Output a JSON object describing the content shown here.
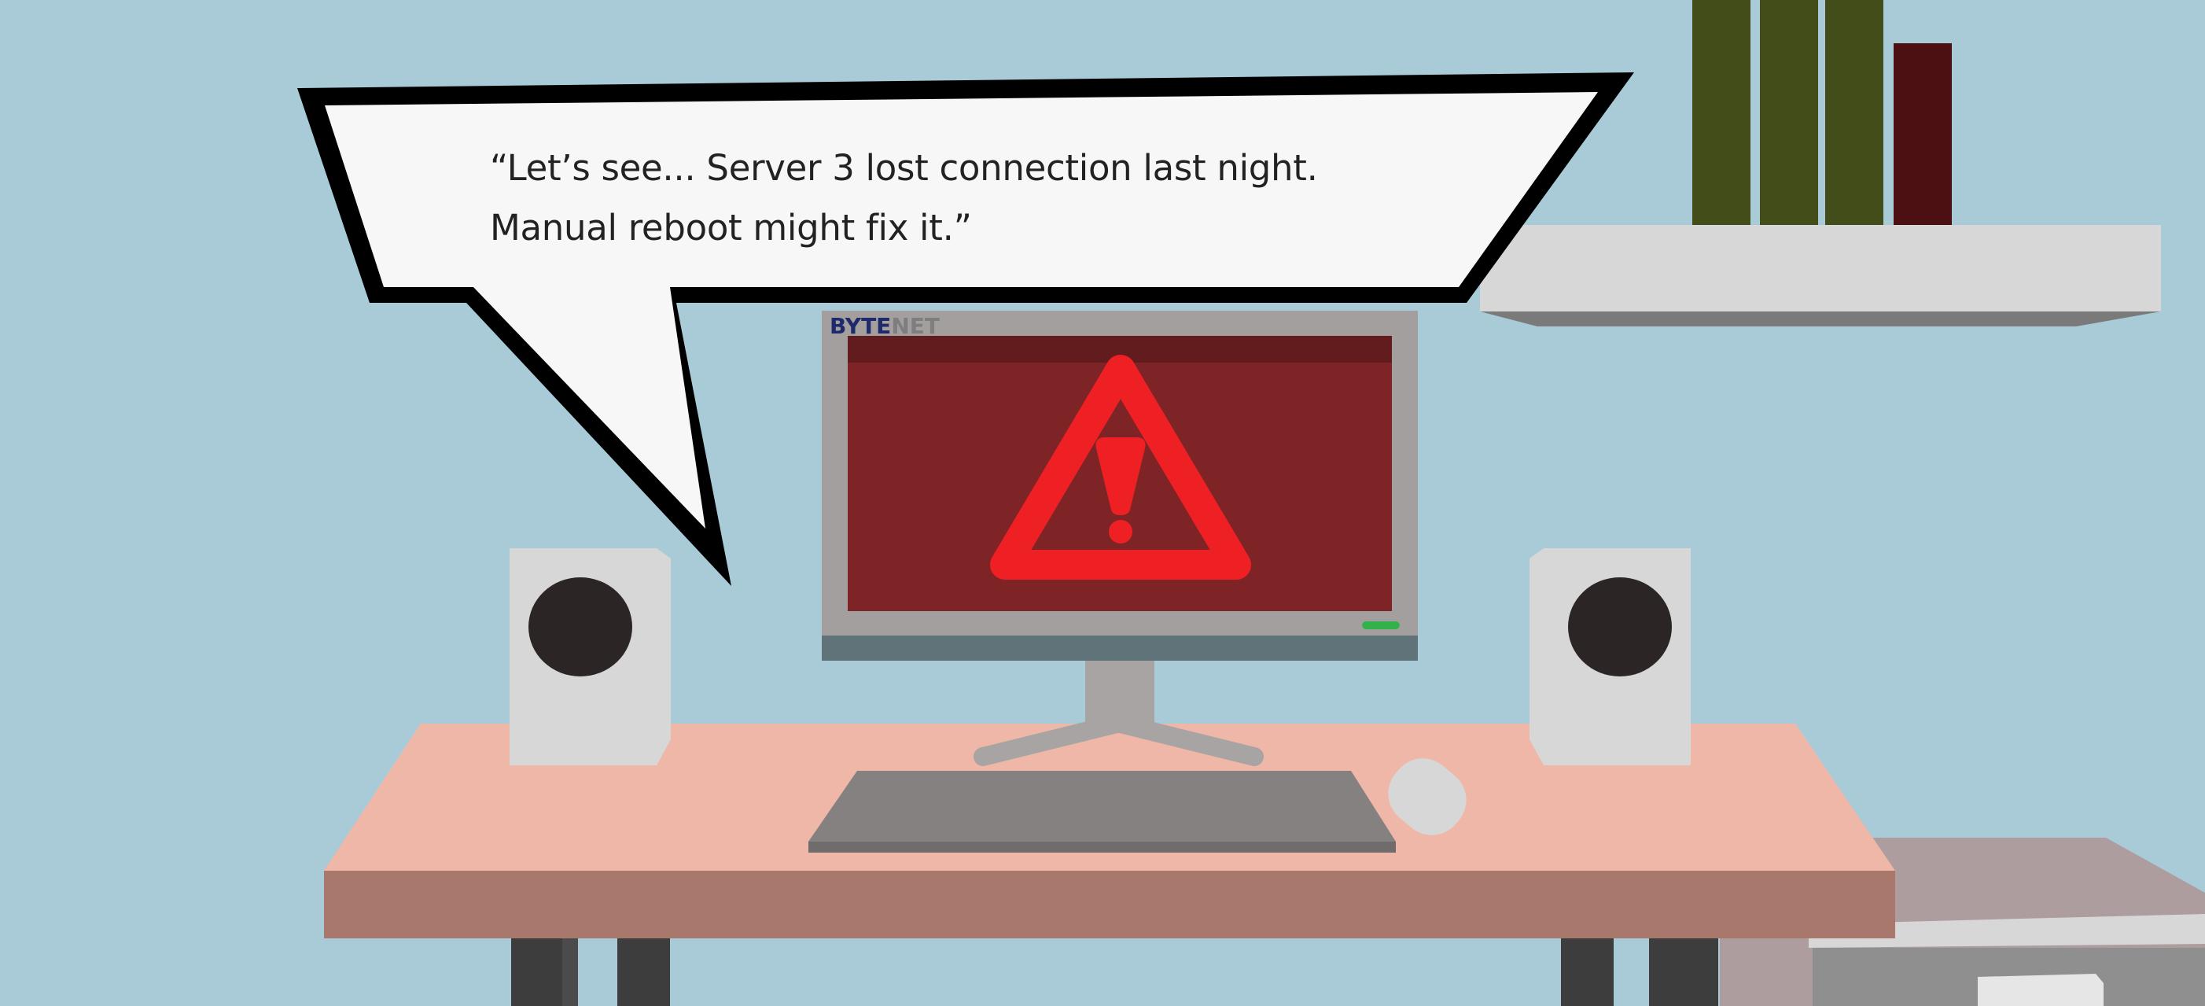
{
  "speech_bubble": {
    "line1": "“Let’s see... Server 3 lost connection last night.",
    "line2": "Manual reboot might fix it.”"
  },
  "monitor": {
    "brand_part1": "BYTE",
    "brand_part2": "NET",
    "screen_icon": "warning-triangle-icon"
  },
  "colors": {
    "wall": "#a9cbd8",
    "desk_top": "#efb7a8",
    "desk_front": "#a8786d",
    "screen": "#7e2427",
    "warning": "#ef2024",
    "power_led": "#33b24b"
  }
}
